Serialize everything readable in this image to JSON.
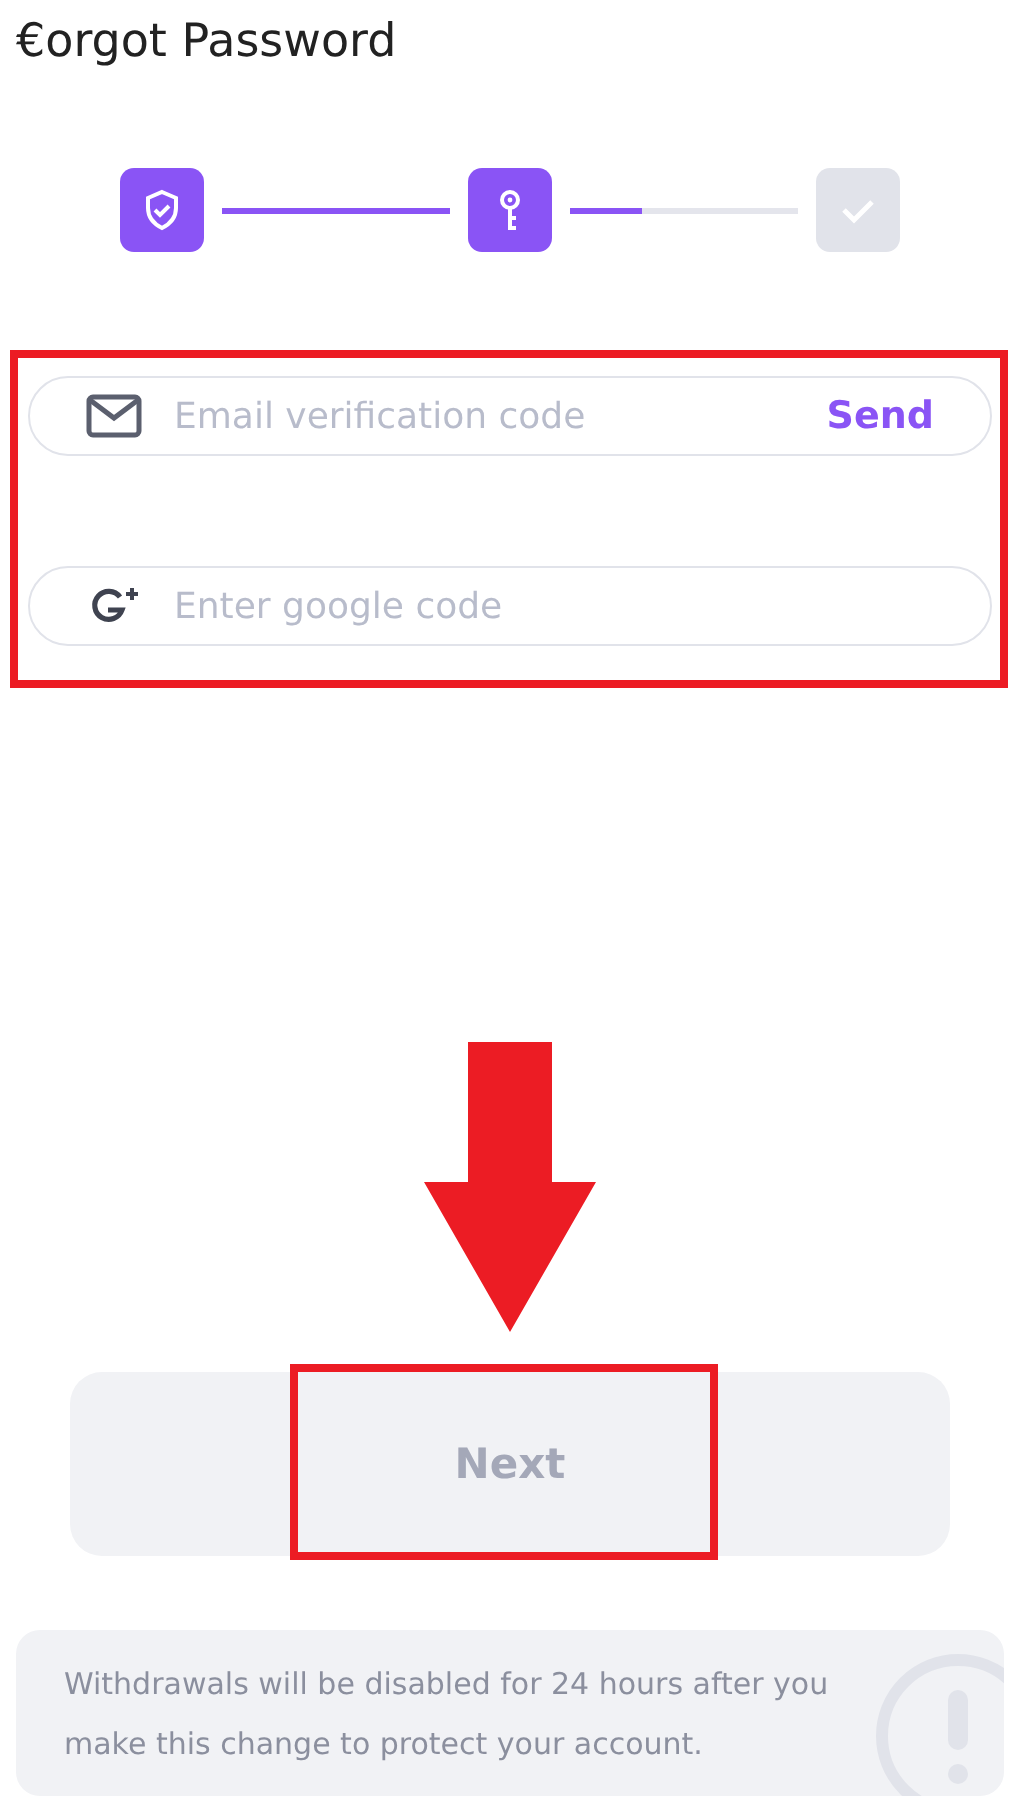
{
  "header": {
    "back_icon": "€",
    "title": "orgot Password"
  },
  "steps": [
    {
      "kind": "shield",
      "active": true
    },
    {
      "kind": "key",
      "active": true
    },
    {
      "kind": "check",
      "active": false
    }
  ],
  "connectors": [
    {
      "level": 1
    },
    {
      "level": 0.32
    }
  ],
  "fields": [
    {
      "kind": "email",
      "placeholder": "Email verification code",
      "action": "Send"
    },
    {
      "kind": "google",
      "placeholder": "Enter google code"
    }
  ],
  "next_button": {
    "label": "Next",
    "disabled": true
  },
  "notice": {
    "text": "Withdrawals will be disabled for 24 hours after you make this change to protect your account."
  }
}
